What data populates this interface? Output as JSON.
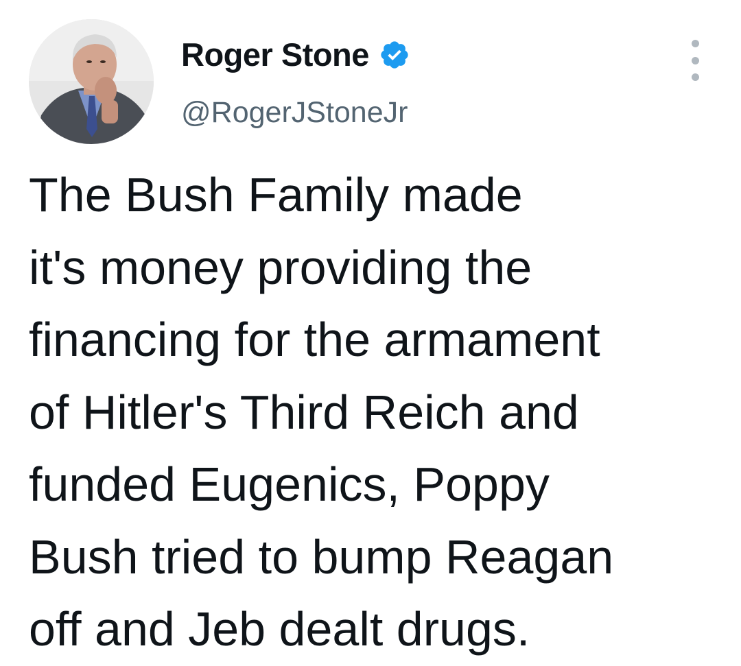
{
  "tweet": {
    "author": {
      "display_name": "Roger Stone",
      "handle": "@RogerJStoneJr",
      "verified": true,
      "avatar_icon": "profile-photo-icon"
    },
    "more_icon": "more-options-icon",
    "text_lines": [
      "The Bush Family made",
      "it's money providing the",
      "financing for the armament",
      "of Hitler's Third Reich and",
      "funded Eugenics, Poppy",
      "Bush tried to bump Reagan",
      "off and Jeb dealt drugs."
    ]
  },
  "colors": {
    "verified_badge": "#1d9bf0",
    "text_primary": "#0f1419",
    "text_secondary": "#536471",
    "background": "#ffffff"
  }
}
